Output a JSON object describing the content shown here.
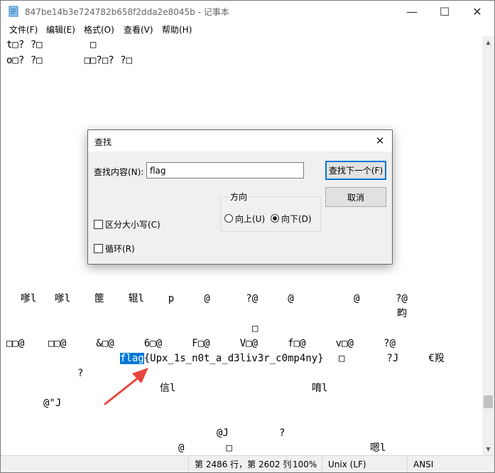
{
  "window": {
    "title": "847be14b3e724782b658f2dda2e8045b - 记事本",
    "minimize": "—",
    "maximize": "☐",
    "close": "✕"
  },
  "menu": [
    {
      "label": "文件(F)"
    },
    {
      "label": "编辑(E)"
    },
    {
      "label": "格式(O)"
    },
    {
      "label": "查看(V)"
    },
    {
      "label": "帮助(H)"
    }
  ],
  "editor": {
    "lines": [
      {
        "text": "t□? ?□        □"
      },
      {
        "text": "o□? ?□       □□?□? ?□"
      },
      {
        "text": "嗲l   嗲l    篚    辊l    p     @      ?@     @          @      ?@"
      },
      {
        "text": "畇             □"
      },
      {
        "text": "□                                                                      ?@"
      },
      {
        "text": "□□@    □□@     &□@     6□@     F□@     V□@     f□@     v□@     ?@"
      },
      {
        "text": "flag"
      },
      {
        "text": "{Upx_1s_n0t_a_d3liv3r_c0mp4ny}"
      },
      {
        "text": "□       ?J     €羖"
      },
      {
        "text": "?"
      },
      {
        "text": "信l"
      },
      {
        "text": "唷l"
      },
      {
        "text": "@\"J"
      },
      {
        "text": "@J"
      },
      {
        "text": "?"
      },
      {
        "text": "@       □"
      },
      {
        "text": "嗯l"
      }
    ]
  },
  "status": {
    "position": "第 2486 行，第 2602 列",
    "zoom": "100%",
    "line_ending": "Unix (LF)",
    "encoding": "ANSI"
  },
  "dialog": {
    "title": "查找",
    "find_label": "查找内容(N):",
    "find_value": "flag",
    "find_next": "查找下一个(F)",
    "cancel": "取消",
    "direction_title": "方向",
    "up": "向上(U)",
    "down": "向下(D)",
    "match_case": "区分大小写(C)",
    "wrap": "循环(R)",
    "direction_selected": "down",
    "match_case_checked": false,
    "wrap_checked": false
  },
  "colors": {
    "selection": "#0078d7",
    "annotation_arrow": "#e8463c"
  }
}
